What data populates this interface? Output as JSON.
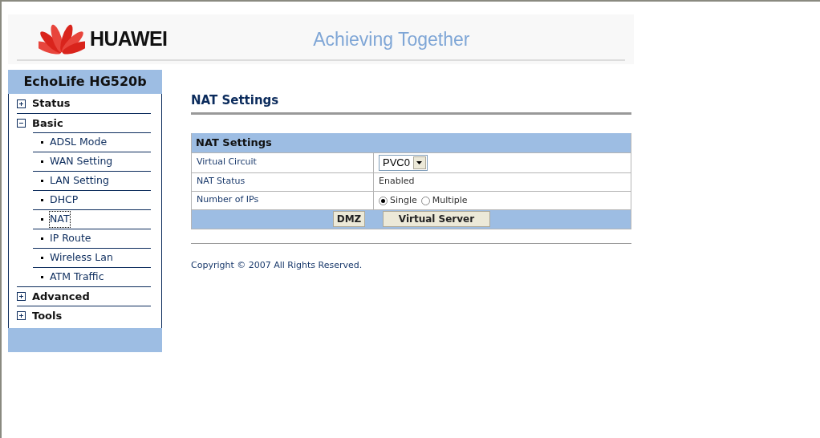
{
  "header": {
    "brand": "HUAWEI",
    "slogan": "Achieving Together"
  },
  "sidebar": {
    "title": "EchoLife HG520b",
    "items": [
      {
        "label": "Status",
        "expanded": false
      },
      {
        "label": "Basic",
        "expanded": true,
        "children": [
          {
            "label": "ADSL Mode",
            "selected": false
          },
          {
            "label": "WAN Setting",
            "selected": false
          },
          {
            "label": "LAN Setting",
            "selected": false
          },
          {
            "label": "DHCP",
            "selected": false
          },
          {
            "label": "NAT",
            "selected": true
          },
          {
            "label": "IP Route",
            "selected": false
          },
          {
            "label": "Wireless Lan",
            "selected": false
          },
          {
            "label": "ATM Traffic",
            "selected": false
          }
        ]
      },
      {
        "label": "Advanced",
        "expanded": false
      },
      {
        "label": "Tools",
        "expanded": false
      }
    ]
  },
  "page_title": "NAT Settings",
  "panel": {
    "title": "NAT Settings",
    "rows": [
      {
        "kind": "select",
        "label": "Virtual Circuit",
        "value": "PVC0"
      },
      {
        "kind": "text",
        "label": "NAT Status",
        "value": "Enabled"
      },
      {
        "kind": "radio",
        "label": "Number of IPs",
        "options": [
          {
            "label": "Single",
            "selected": true
          },
          {
            "label": "Multiple",
            "selected": false
          }
        ]
      }
    ],
    "buttons": [
      "DMZ",
      "Virtual Server"
    ]
  },
  "footer": "Copyright © 2007 All Rights Reserved."
}
